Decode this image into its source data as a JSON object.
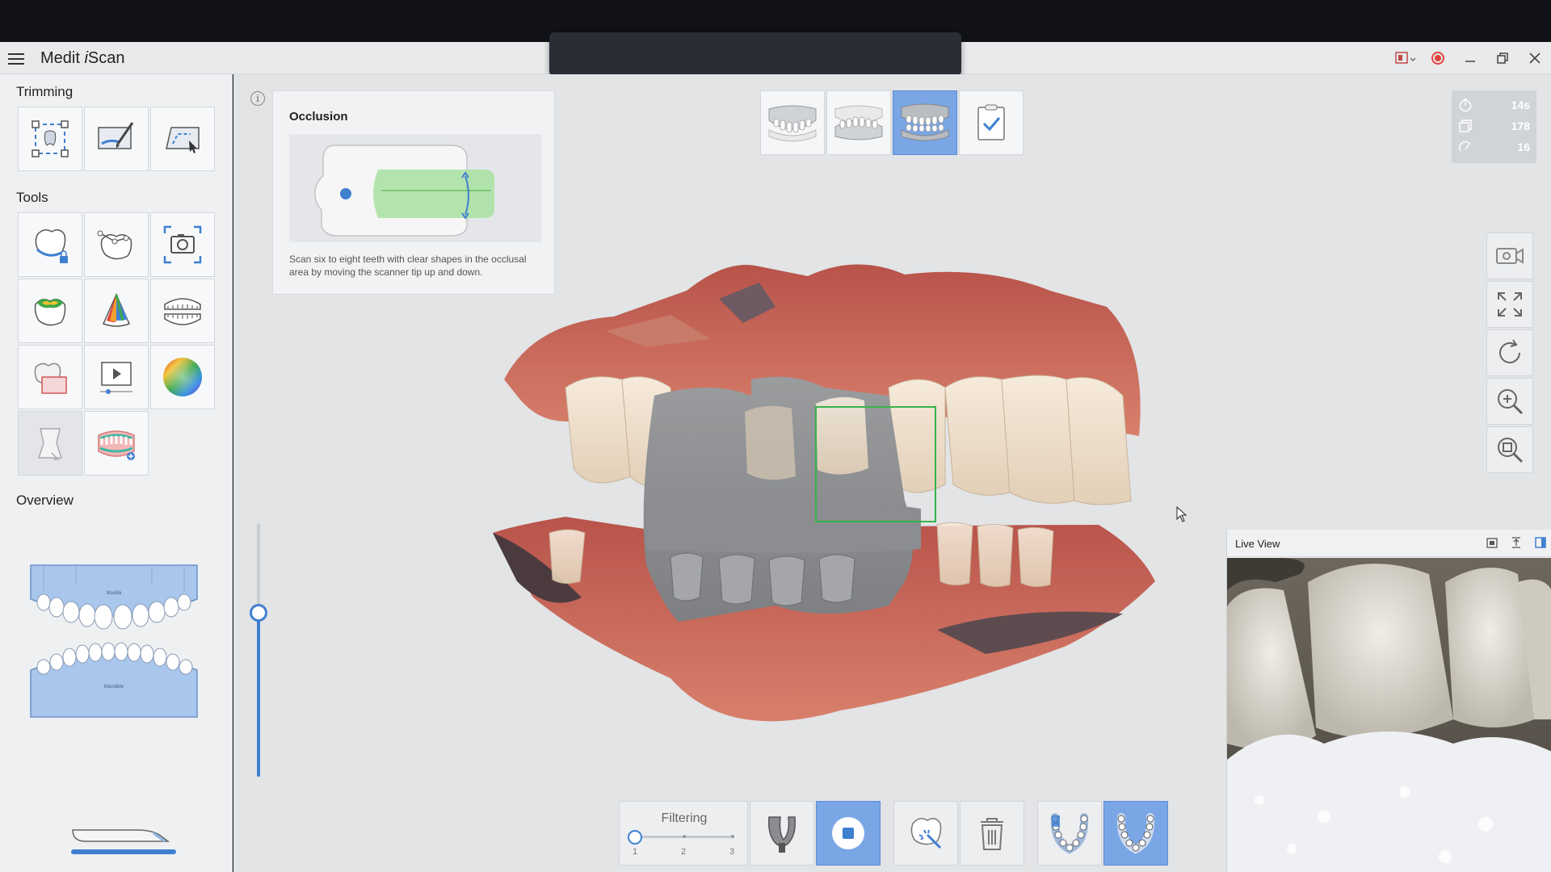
{
  "app": {
    "title_prefix": "Medit ",
    "title_italic": "i",
    "title_suffix": "Scan"
  },
  "left_panel": {
    "trimming_label": "Trimming",
    "tools_label": "Tools",
    "overview_label": "Overview",
    "overview_upper_text": "Maxilla",
    "overview_lower_text": "Mandible"
  },
  "guide": {
    "title": "Occlusion",
    "description": "Scan six to eight teeth with clear shapes in the occlusal area by moving the scanner tip up and down."
  },
  "stats": {
    "time": "14s",
    "frames": "178",
    "rate": "16"
  },
  "live_view": {
    "title": "Live View"
  },
  "filter": {
    "label": "Filtering",
    "ticks": [
      "1",
      "2",
      "3"
    ],
    "level": 0
  },
  "info_icon": "i",
  "colors": {
    "accent": "#3f7fd0",
    "active_button": "#7aa6e6",
    "record": "#e0433b",
    "scan_box": "#35b44a"
  }
}
